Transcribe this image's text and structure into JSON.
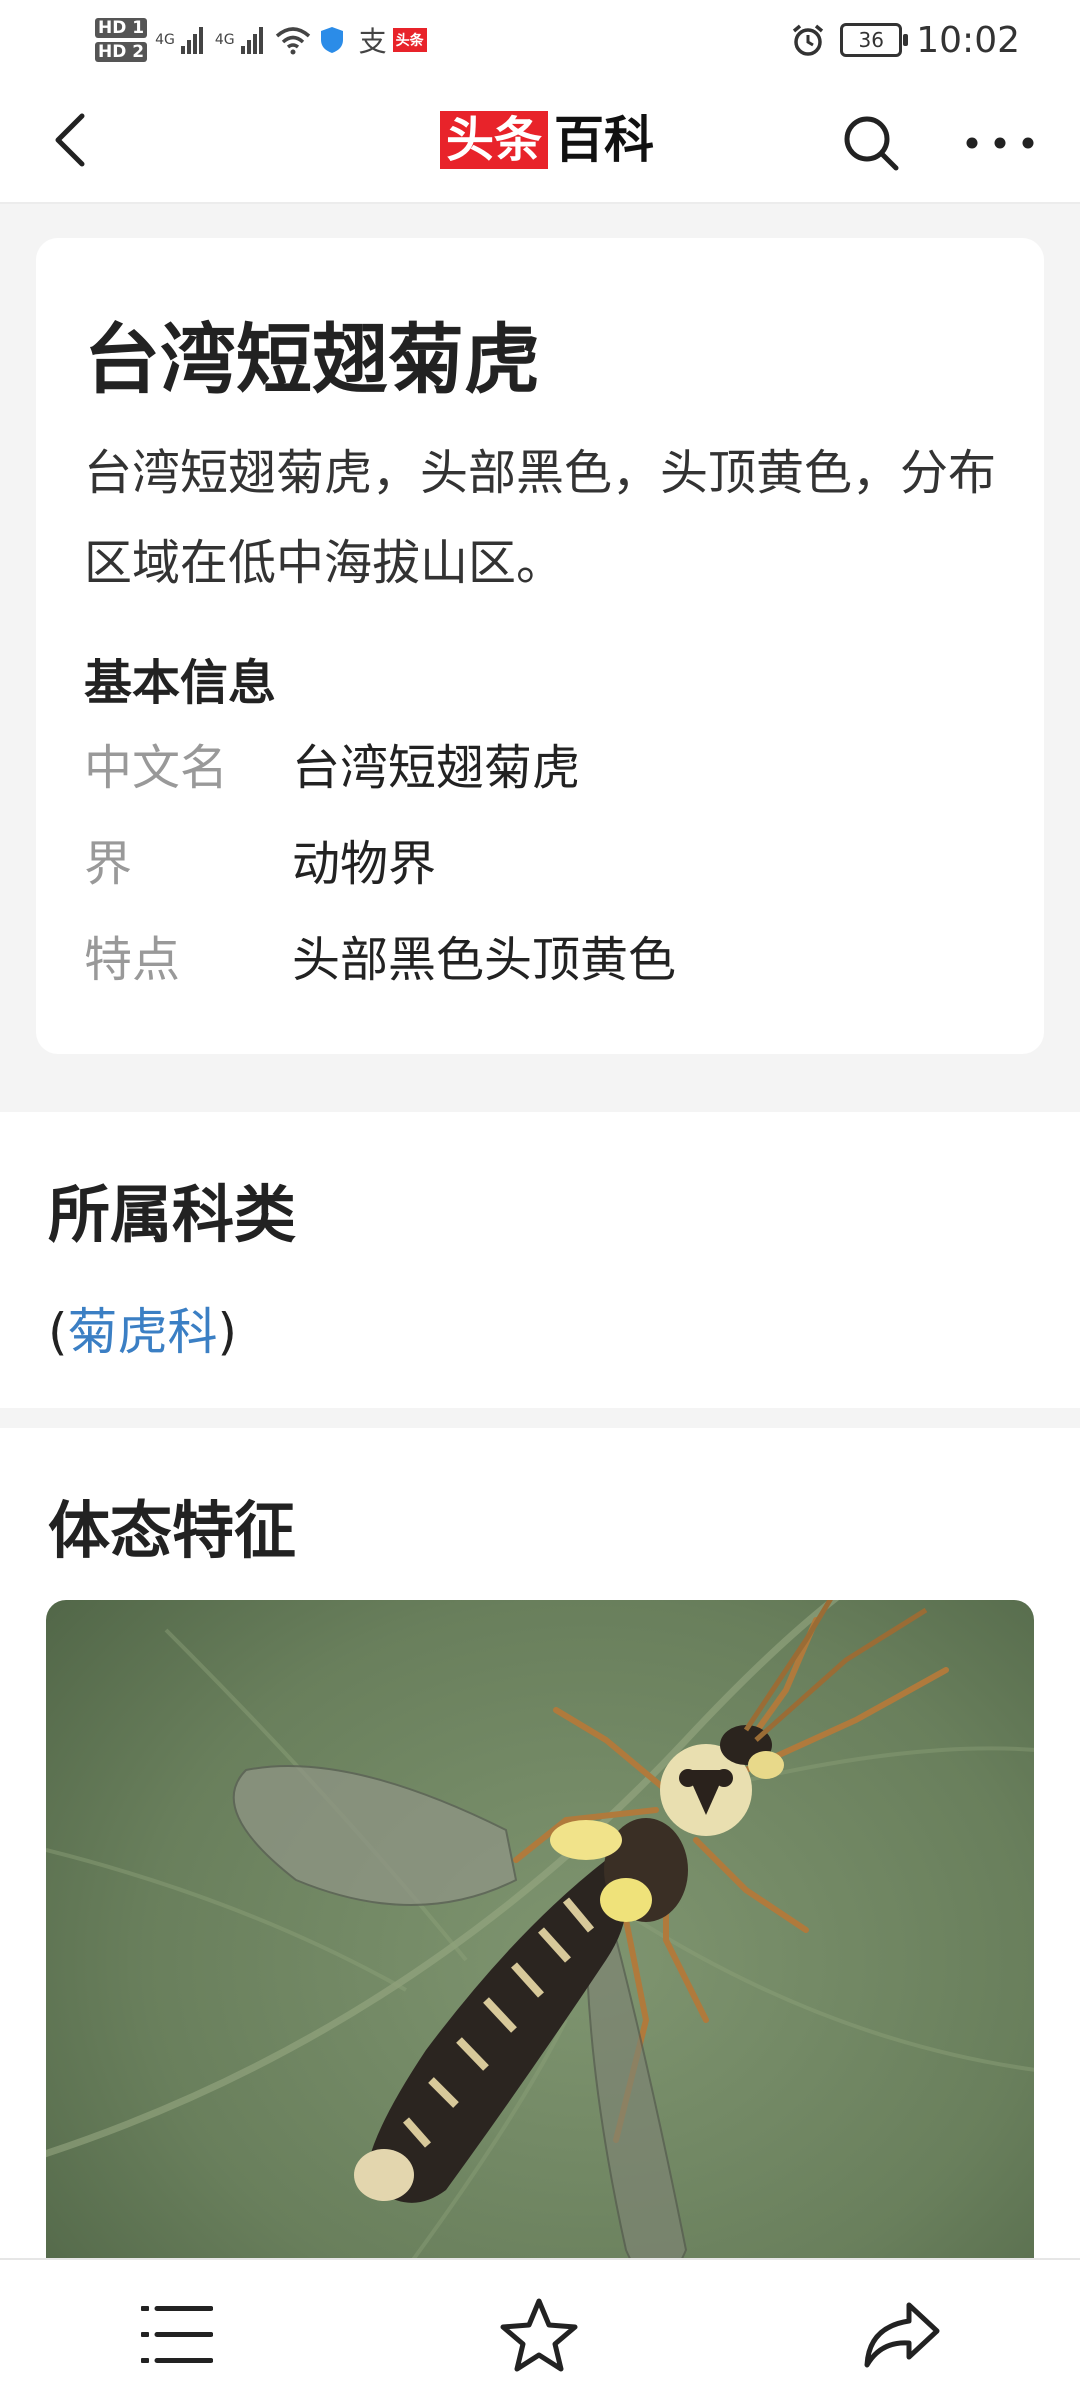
{
  "status_bar": {
    "hd1": "HD 1",
    "hd2": "HD 2",
    "net1": "4G",
    "net2": "4G",
    "alipay_glyph": "支",
    "toutiao_badge": "头条",
    "battery": "36",
    "time": "10:02"
  },
  "nav": {
    "logo_red": "头条",
    "logo_black": "百科"
  },
  "summary": {
    "title": "台湾短翅菊虎",
    "description": "台湾短翅菊虎，头部黑色，头顶黄色，分布区域在低中海拔山区。",
    "info_heading": "基本信息",
    "info": [
      {
        "key": "中文名",
        "value": "台湾短翅菊虎"
      },
      {
        "key": "界",
        "value": "动物界"
      },
      {
        "key": "特点",
        "value": "头部黑色头顶黄色"
      }
    ]
  },
  "family_section": {
    "title": "所属科类",
    "open_paren": "(",
    "family_link": "菊虎科",
    "close_paren": ")"
  },
  "morphology_section": {
    "title": "体态特征"
  },
  "icons": {
    "back": "chevron-left-icon",
    "search": "search-icon",
    "more": "more-dots-icon",
    "menu": "list-menu-icon",
    "favorite": "star-icon",
    "share": "share-icon"
  },
  "colors": {
    "brand_red": "#e8232a",
    "link_blue": "#3b7fc4",
    "label_gray": "#999999"
  }
}
